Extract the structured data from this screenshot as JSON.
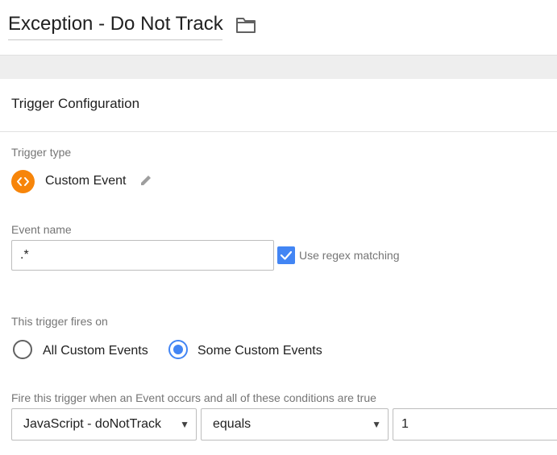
{
  "header": {
    "title": "Exception - Do Not Track",
    "folder_icon": "folder-icon"
  },
  "trigger_config": {
    "heading": "Trigger Configuration",
    "trigger_type_label": "Trigger type",
    "trigger_type": {
      "name": "Custom Event",
      "icon": "code-brackets-icon",
      "icon_color": "#f7850a",
      "edit_icon": "pencil-icon"
    },
    "event_name_label": "Event name",
    "event_name_value": ".*",
    "regex_checkbox": {
      "label": "Use regex matching",
      "checked": true,
      "color": "#4285f4"
    },
    "fires_on_label": "This trigger fires on",
    "fires_on_options": [
      {
        "label": "All Custom Events",
        "selected": false
      },
      {
        "label": "Some Custom Events",
        "selected": true
      }
    ],
    "conditions_label": "Fire this trigger when an Event occurs and all of these conditions are true",
    "condition": {
      "variable": "JavaScript - doNotTrack",
      "operator": "equals",
      "value": "1"
    }
  },
  "accent_color": "#4285f4"
}
